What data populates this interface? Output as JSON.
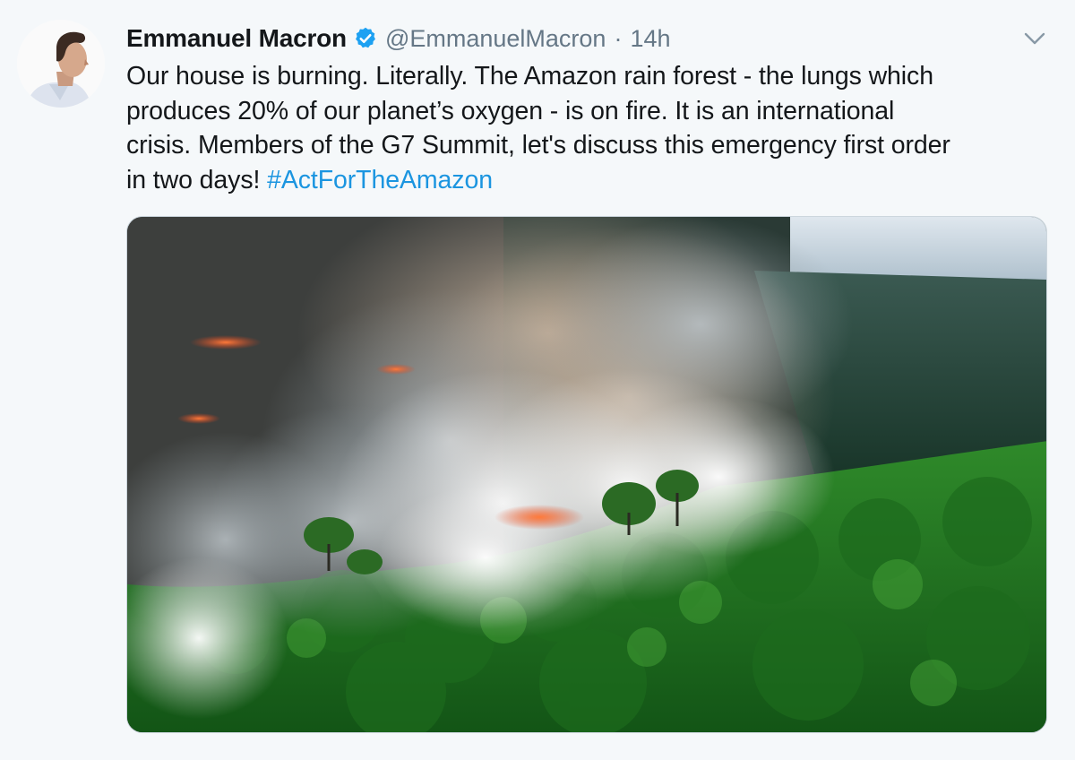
{
  "tweet": {
    "author": {
      "name": "Emmanuel Macron",
      "handle": "@EmmanuelMacron",
      "separator": "·",
      "time": "14h",
      "verified": true,
      "avatar_icon": "person-profile-photo"
    },
    "text": {
      "line1": "Our house is burning. Literally. The Amazon rain forest - the lungs which",
      "line2": "produces 20% of our planet’s oxygen - is on fire. It is an international",
      "line3": "crisis. Members of the G7 Summit, let's discuss this emergency first order",
      "line4_prefix": "in two days! ",
      "hashtag": "#ActForTheAmazon"
    },
    "media": {
      "type": "photo",
      "icon": "amazon-forest-fire-aerial-photo"
    },
    "menu_icon": "chevron-down-icon"
  },
  "colors": {
    "background": "#f5f8fa",
    "text": "#14171a",
    "secondary_text": "#657786",
    "link": "#1b95e0",
    "verified_badge": "#1da1f2"
  }
}
